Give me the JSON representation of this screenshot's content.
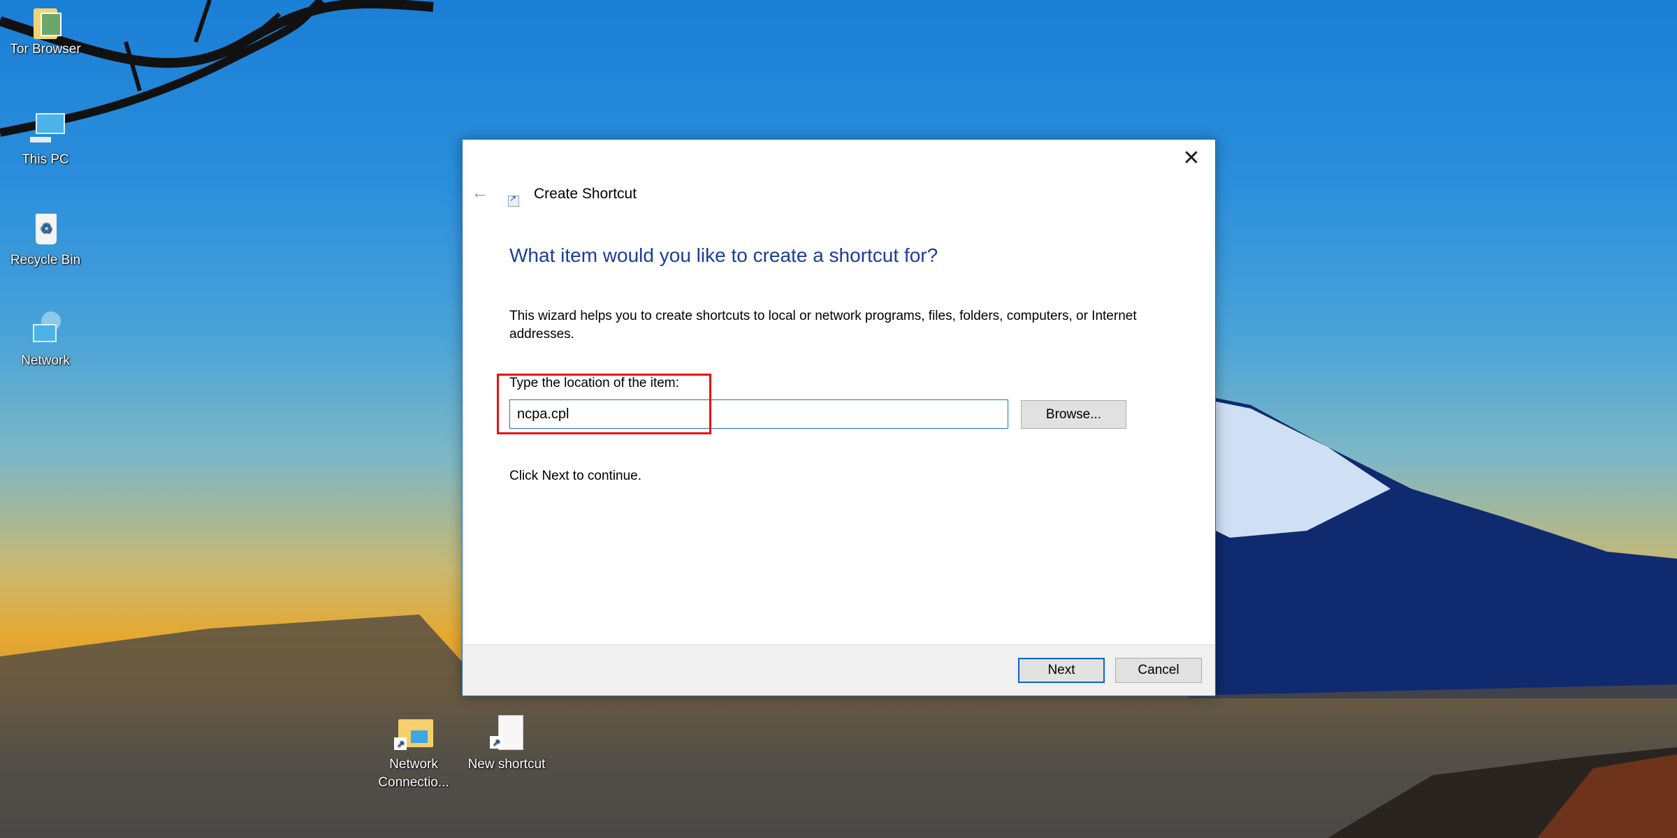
{
  "desktop": {
    "icons": [
      {
        "label": "Tor Browser",
        "icon": "tor-browser-folder-icon"
      },
      {
        "label": "This PC",
        "icon": "computer-icon"
      },
      {
        "label": "Recycle Bin",
        "icon": "recycle-bin-icon"
      },
      {
        "label": "Network",
        "icon": "network-icon"
      },
      {
        "label": "Network Connectio...",
        "icon": "folder-shortcut-icon"
      },
      {
        "label": "New shortcut",
        "icon": "file-shortcut-icon"
      }
    ]
  },
  "dialog": {
    "title": "Create Shortcut",
    "close_glyph": "✕",
    "back_glyph": "←",
    "heading": "What item would you like to create a shortcut for?",
    "description": "This wizard helps you to create shortcuts to local or network programs, files, folders, computers, or Internet addresses.",
    "location_label": "Type the location of the item:",
    "location_value": "ncpa.cpl",
    "browse_label": "Browse...",
    "hint": "Click Next to continue.",
    "next_label": "Next",
    "cancel_label": "Cancel"
  },
  "annotation": {
    "color": "#e81010",
    "target": "location-field"
  }
}
